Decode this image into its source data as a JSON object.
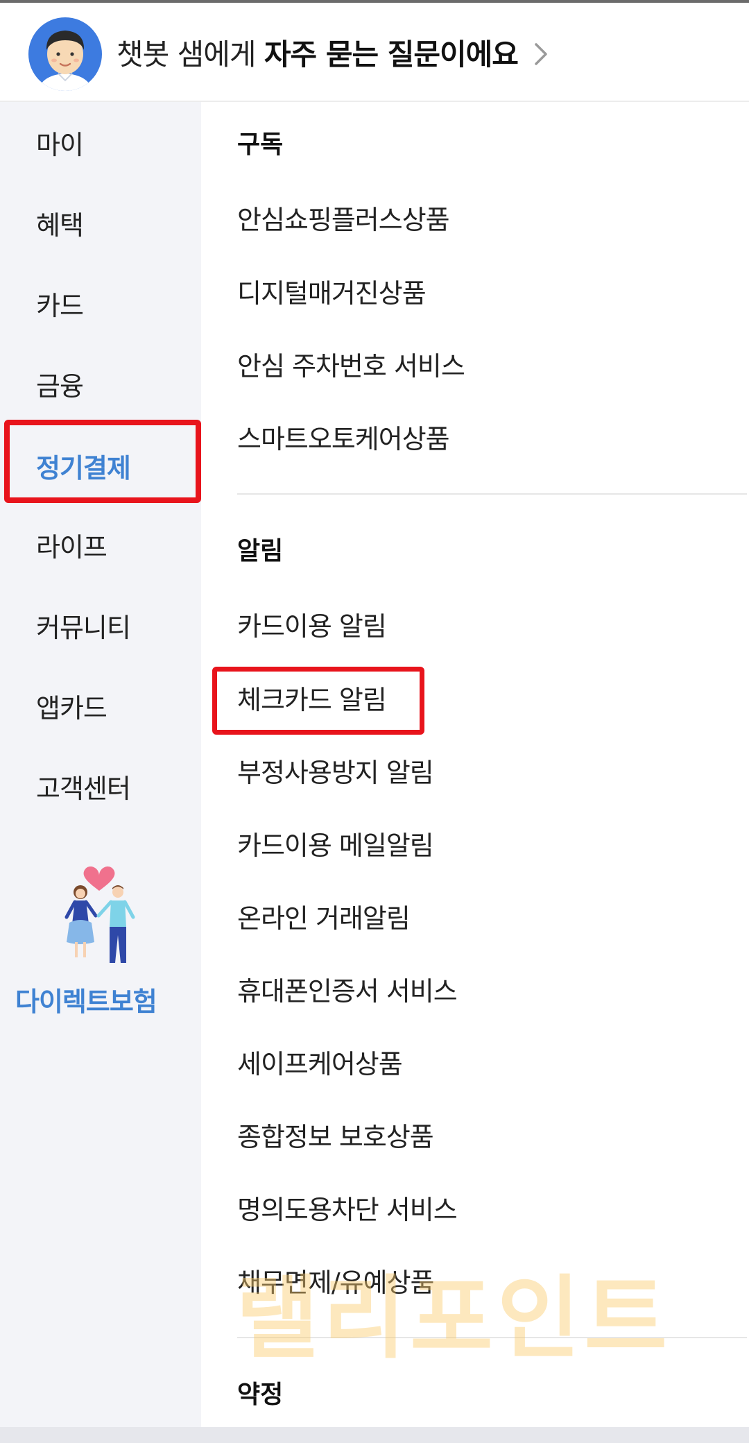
{
  "header": {
    "prefix": "챗봇 샘에게",
    "bold": "자주 묻는 질문이에요"
  },
  "sidebar": {
    "items": [
      {
        "label": "마이"
      },
      {
        "label": "혜택"
      },
      {
        "label": "카드"
      },
      {
        "label": "금융"
      },
      {
        "label": "정기결제",
        "active": true
      },
      {
        "label": "라이프"
      },
      {
        "label": "커뮤니티"
      },
      {
        "label": "앱카드"
      },
      {
        "label": "고객센터"
      }
    ],
    "promo_label": "다이렉트보험"
  },
  "main": {
    "sections": [
      {
        "title": "구독",
        "items": [
          "안심쇼핑플러스상품",
          "디지털매거진상품",
          "안심 주차번호 서비스",
          "스마트오토케어상품"
        ]
      },
      {
        "title": "알림",
        "items": [
          "카드이용 알림",
          "체크카드 알림",
          "부정사용방지 알림",
          "카드이용 메일알림",
          "온라인 거래알림",
          "휴대폰인증서 서비스",
          "세이프케어상품",
          "종합정보 보호상품",
          "명의도용차단 서비스",
          "채무면제/유예상품"
        ]
      },
      {
        "title": "약정",
        "items": []
      }
    ]
  },
  "watermark": "랠리포인트",
  "colors": {
    "accent": "#3f82d2",
    "highlight_box": "#e8141c",
    "sidebar_bg": "#f3f4f8"
  }
}
